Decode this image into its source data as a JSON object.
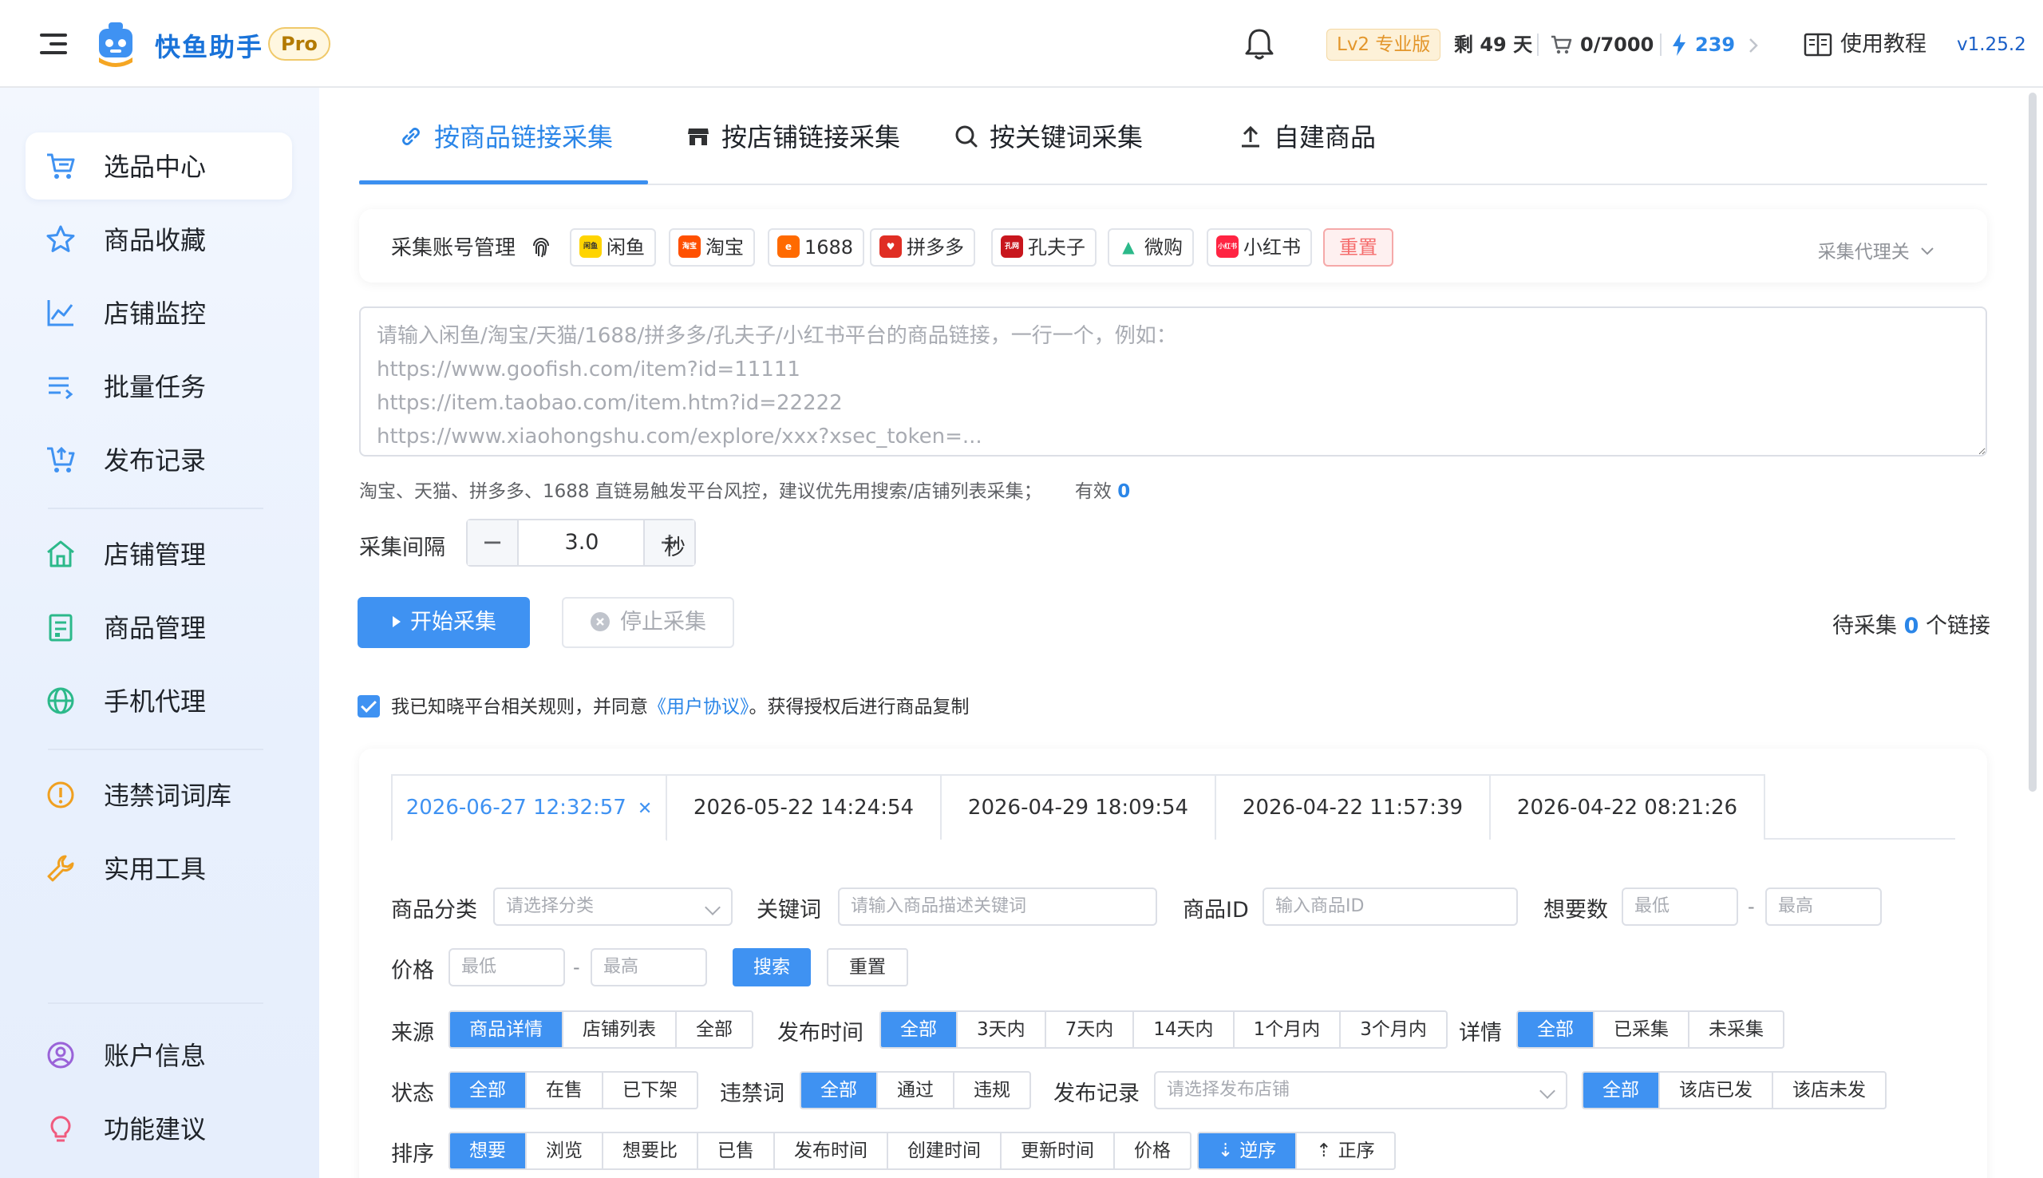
{
  "header": {
    "app_name": "快鱼助手",
    "pro_badge": "Pro",
    "level_badge": "Lv2 专业版",
    "days_left": "剩 49 天",
    "cart_count": "0/7000",
    "points": "239",
    "help_label": "使用教程",
    "version": "v1.25.2"
  },
  "sidebar": {
    "items": [
      {
        "label": "选品中心",
        "icon": "cart-icon"
      },
      {
        "label": "商品收藏",
        "icon": "star-icon"
      },
      {
        "label": "店铺监控",
        "icon": "line-chart-icon"
      },
      {
        "label": "批量任务",
        "icon": "list-icon"
      },
      {
        "label": "发布记录",
        "icon": "cart-upload-icon"
      },
      {
        "label": "店铺管理",
        "icon": "home-icon"
      },
      {
        "label": "商品管理",
        "icon": "clipboard-icon"
      },
      {
        "label": "手机代理",
        "icon": "globe-icon"
      },
      {
        "label": "违禁词词库",
        "icon": "warning-icon"
      },
      {
        "label": "实用工具",
        "icon": "wrench-icon"
      },
      {
        "label": "账户信息",
        "icon": "user-icon"
      },
      {
        "label": "功能建议",
        "icon": "bulb-icon"
      }
    ]
  },
  "tabs": [
    {
      "label": "按商品链接采集",
      "icon": "link-icon"
    },
    {
      "label": "按店铺链接采集",
      "icon": "shop-icon"
    },
    {
      "label": "按关键词采集",
      "icon": "search-icon"
    },
    {
      "label": "自建商品",
      "icon": "upload-icon"
    }
  ],
  "account": {
    "title": "采集账号管理",
    "platforms": [
      "闲鱼",
      "淘宝",
      "1688",
      "拼多多",
      "孔夫子",
      "微购",
      "小红书"
    ],
    "reset": "重置",
    "proxy_toggle": "采集代理关"
  },
  "link_input": {
    "placeholder": "请输入闲鱼/淘宝/天猫/1688/拼多多/孔夫子/小红书平台的商品链接，一行一个，例如：\nhttps://www.goofish.com/item?id=11111\nhttps://item.taobao.com/item.htm?id=22222\nhttps://www.xiaohongshu.com/explore/xxx?xsec_token=..."
  },
  "hint": {
    "text": "淘宝、天猫、拼多多、1688 直链易触发平台风控，建议优先用搜索/店铺列表采集；",
    "valid_label": "有效",
    "valid_count": "0"
  },
  "interval": {
    "label": "采集间隔",
    "value": "3.0",
    "unit": "秒",
    "minus": "−",
    "plus": "+"
  },
  "actions": {
    "start": "开始采集",
    "stop": "停止采集",
    "pending_prefix": "待采集",
    "pending_count": "0",
    "pending_suffix": "个链接"
  },
  "agreement": {
    "text_before": "我已知晓平台相关规则，并同意",
    "link": "《用户协议》",
    "text_after": "。获得授权后进行商品复制"
  },
  "history_tabs": [
    "2026-06-27 12:32:57",
    "2026-05-22 14:24:54",
    "2026-04-29 18:09:54",
    "2026-04-22 11:57:39",
    "2026-04-22 08:21:26"
  ],
  "filters": {
    "category_label": "商品分类",
    "category_placeholder": "请选择分类",
    "keyword_label": "关键词",
    "keyword_placeholder": "请输入商品描述关键词",
    "id_label": "商品ID",
    "id_placeholder": "输入商品ID",
    "want_label": "想要数",
    "min_placeholder": "最低",
    "max_placeholder": "最高",
    "price_label": "价格",
    "dash": "-",
    "search_btn": "搜索",
    "reset_btn": "重置",
    "source_label": "来源",
    "source_opts": [
      "商品详情",
      "店铺列表",
      "全部"
    ],
    "pubtime_label": "发布时间",
    "pubtime_opts": [
      "全部",
      "3天内",
      "7天内",
      "14天内",
      "1个月内",
      "3个月内"
    ],
    "detail_label": "详情",
    "detail_opts": [
      "全部",
      "已采集",
      "未采集"
    ],
    "status_label": "状态",
    "status_opts": [
      "全部",
      "在售",
      "已下架"
    ],
    "banned_label": "违禁词",
    "banned_opts": [
      "全部",
      "通过",
      "违规"
    ],
    "pubrec_label": "发布记录",
    "pubrec_placeholder": "请选择发布店铺",
    "pubrec_opts": [
      "全部",
      "该店已发",
      "该店未发"
    ],
    "sort_label": "排序",
    "sort_opts": [
      "想要",
      "浏览",
      "想要比",
      "已售",
      "发布时间",
      "创建时间",
      "更新时间",
      "价格"
    ],
    "order_opts": [
      "逆序",
      "正序"
    ]
  },
  "colors": {
    "primary": "#3f92f2",
    "brand": "#1a73d9",
    "danger": "#f56c6c",
    "warning": "#e3962b"
  }
}
